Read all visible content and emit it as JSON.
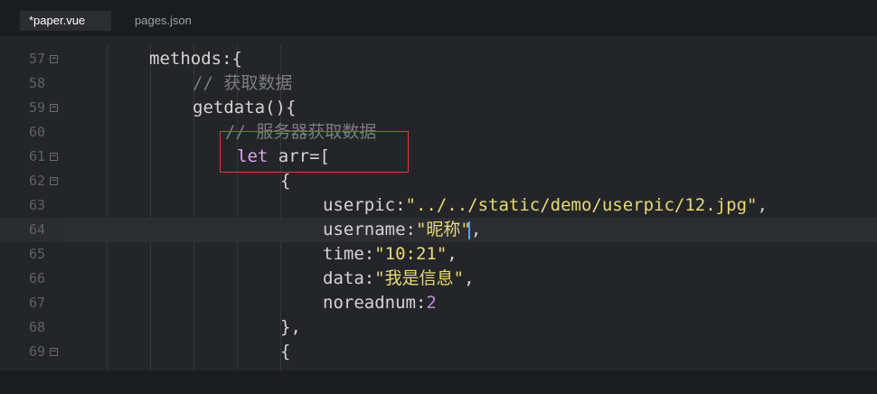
{
  "tabs": [
    {
      "label": "*paper.vue",
      "active": true
    },
    {
      "label": "pages.json",
      "active": false
    }
  ],
  "lines": [
    {
      "num": "57",
      "fold": true,
      "code": "methods:{"
    },
    {
      "num": "58",
      "fold": false,
      "code": "// 获取数据"
    },
    {
      "num": "59",
      "fold": true,
      "code": "getdata(){"
    },
    {
      "num": "60",
      "fold": false,
      "code": "// 服务器获取数据"
    },
    {
      "num": "61",
      "fold": true,
      "code": "let arr=["
    },
    {
      "num": "62",
      "fold": true,
      "code": "{"
    },
    {
      "num": "63",
      "fold": false,
      "code": "userpic:\"../../static/demo/userpic/12.jpg\","
    },
    {
      "num": "64",
      "fold": false,
      "code": "username:\"昵称\","
    },
    {
      "num": "65",
      "fold": false,
      "code": "time:\"10:21\","
    },
    {
      "num": "66",
      "fold": false,
      "code": "data:\"我是信息\","
    },
    {
      "num": "67",
      "fold": false,
      "code": "noreadnum:2"
    },
    {
      "num": "68",
      "fold": false,
      "code": "},"
    },
    {
      "num": "69",
      "fold": true,
      "code": "{"
    }
  ],
  "tokens": {
    "l57": "methods:{",
    "l58": "// 获取数据",
    "l59": "getdata(){",
    "l60": "// 服务器获取数据",
    "l61_kw": "let",
    "l61_rest": " arr=[",
    "l62": "{",
    "l63_key": "userpic:",
    "l63_str": "\"../../static/demo/userpic/12.jpg\"",
    "l63_end": ",",
    "l64_key": "username:",
    "l64_str": "\"昵称\"",
    "l64_end": ",",
    "l65_key": "time:",
    "l65_str": "\"10:21\"",
    "l65_end": ",",
    "l66_key": "data:",
    "l66_str": "\"我是信息\"",
    "l66_end": ",",
    "l67_key": "noreadnum:",
    "l67_num": "2",
    "l68": "},",
    "l69": "{"
  },
  "colors": {
    "keyword": "#d7a6e8",
    "string": "#e6db74",
    "number": "#b98ee0",
    "comment": "#7b7d82",
    "highlight_box": "#e23b3b",
    "cursor": "#4fa3ff"
  },
  "icons": {
    "fold": "fold-minus-icon"
  }
}
